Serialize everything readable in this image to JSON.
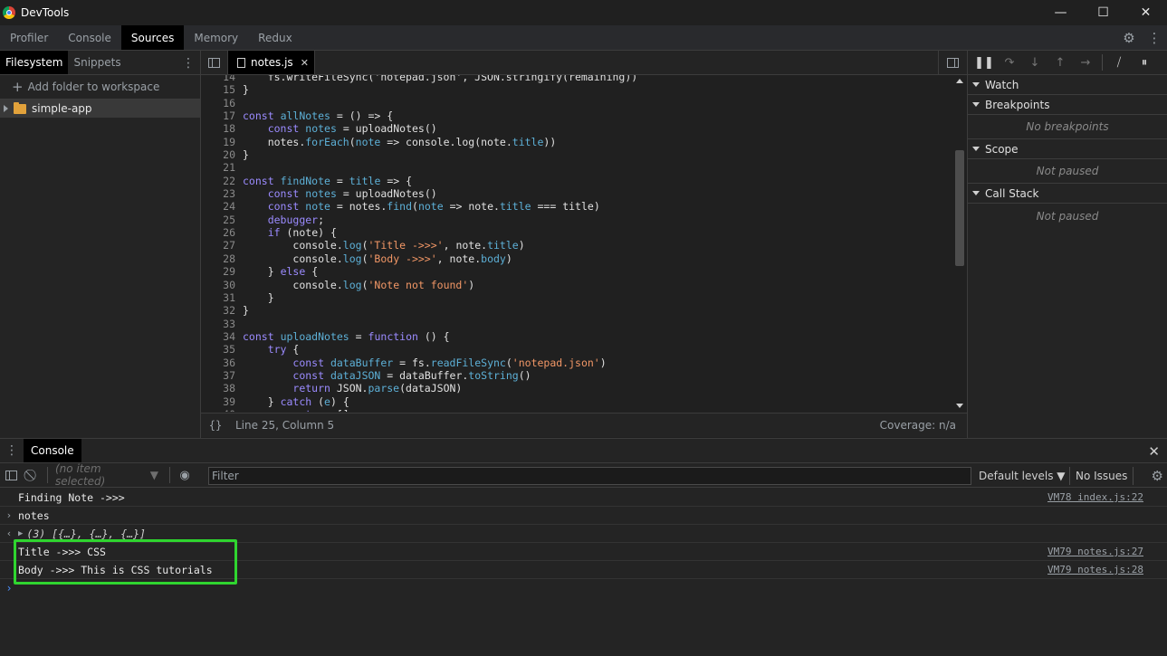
{
  "window": {
    "title": "DevTools",
    "minimize": "—",
    "maximize": "☐",
    "close": "✕"
  },
  "main_tabs": [
    {
      "label": "Profiler"
    },
    {
      "label": "Console"
    },
    {
      "label": "Sources"
    },
    {
      "label": "Memory"
    },
    {
      "label": "Redux"
    }
  ],
  "navigator": {
    "tabs": [
      "Filesystem",
      "Snippets"
    ],
    "add_folder": "Add folder to workspace",
    "tree_item": "simple-app"
  },
  "editor": {
    "file_tab": "notes.js",
    "status_position": "Line 25, Column 5",
    "coverage": "Coverage: n/a",
    "braces": "{}"
  },
  "debugger": {
    "watch": "Watch",
    "breakpoints": "Breakpoints",
    "no_breakpoints": "No breakpoints",
    "scope": "Scope",
    "scope_status": "Not paused",
    "call_stack": "Call Stack",
    "call_stack_status": "Not paused"
  },
  "drawer": {
    "tab": "Console",
    "context": "(no item selected)",
    "filter_placeholder": "Filter",
    "levels": "Default levels ▼",
    "issues": "No Issues"
  },
  "console": {
    "msg1": "Finding Note ->>>",
    "msg1_link": "VM78 index.js:22",
    "input": "notes",
    "result": "(3) [{…}, {…}, {…}]",
    "msg2": "Title ->>> CSS",
    "msg2_link": "VM79 notes.js:27",
    "msg3": "Body ->>> This is CSS tutorials",
    "msg3_link": "VM79 notes.js:28"
  },
  "code": {
    "l14": "    fs.writeFileSync('notepad.json', JSON.stringify(remaining))",
    "l15": "}",
    "l16": "",
    "l17_kw": "const",
    "l17_fn": "allNotes",
    "l17_rest": "= () => {",
    "l18_kw": "const",
    "l18_v": "notes",
    "l18_rest": "= uploadNotes()",
    "l19_a": "notes.",
    "l19_fn": "forEach",
    "l19_b": "(",
    "l19_p": "note",
    "l19_c": " => console.log(note.",
    "l19_d": "title",
    "l19_e": "))",
    "l20": "}",
    "l21": "",
    "l22_kw": "const",
    "l22_fn": "findNote",
    "l22_eq": "=",
    "l22_p": "title",
    "l22_rest": "=> {",
    "l23_kw": "const",
    "l23_v": "notes",
    "l23_rest": "= uploadNotes()",
    "l24_kw": "const",
    "l24_v": "note",
    "l24_a": "= notes.",
    "l24_fn": "find",
    "l24_b": "(",
    "l24_p": "note",
    "l24_c": " => note.",
    "l24_d": "title",
    "l24_e": " === title)",
    "l25_kw": "debugger",
    "l26_kw": "if",
    "l26_rest": "(note) {",
    "l27_a": "console.",
    "l27_fn": "log",
    "l27_b": "(",
    "l27_s": "'Title ->>>'",
    "l27_c": ", note.",
    "l27_d": "title",
    "l27_e": ")",
    "l28_a": "console.",
    "l28_fn": "log",
    "l28_b": "(",
    "l28_s": "'Body ->>>'",
    "l28_c": ", note.",
    "l28_d": "body",
    "l28_e": ")",
    "l29_a": "} ",
    "l29_kw": "else",
    "l29_b": " {",
    "l30_a": "console.",
    "l30_fn": "log",
    "l30_b": "(",
    "l30_s": "'Note not found'",
    "l30_e": ")",
    "l31": "}",
    "l32": "}",
    "l33": "",
    "l34_kw": "const",
    "l34_fn": "uploadNotes",
    "l34_eq": "=",
    "l34_kw2": "function",
    "l34_rest": "() {",
    "l35_kw": "try",
    "l35_rest": " {",
    "l36_kw": "const",
    "l36_v": "dataBuffer",
    "l36_a": "= fs.",
    "l36_fn": "readFileSync",
    "l36_b": "(",
    "l36_s": "'notepad.json'",
    "l36_e": ")",
    "l37_kw": "const",
    "l37_v": "dataJSON",
    "l37_a": "= dataBuffer.",
    "l37_fn": "toString",
    "l37_e": "()",
    "l38_kw": "return",
    "l38_a": " JSON.",
    "l38_fn": "parse",
    "l38_e": "(dataJSON)",
    "l39_a": "} ",
    "l39_kw": "catch",
    "l39_b": " (",
    "l39_p": "e",
    "l39_e": ") {",
    "l40_kw": "return",
    "l40_e": " []"
  }
}
